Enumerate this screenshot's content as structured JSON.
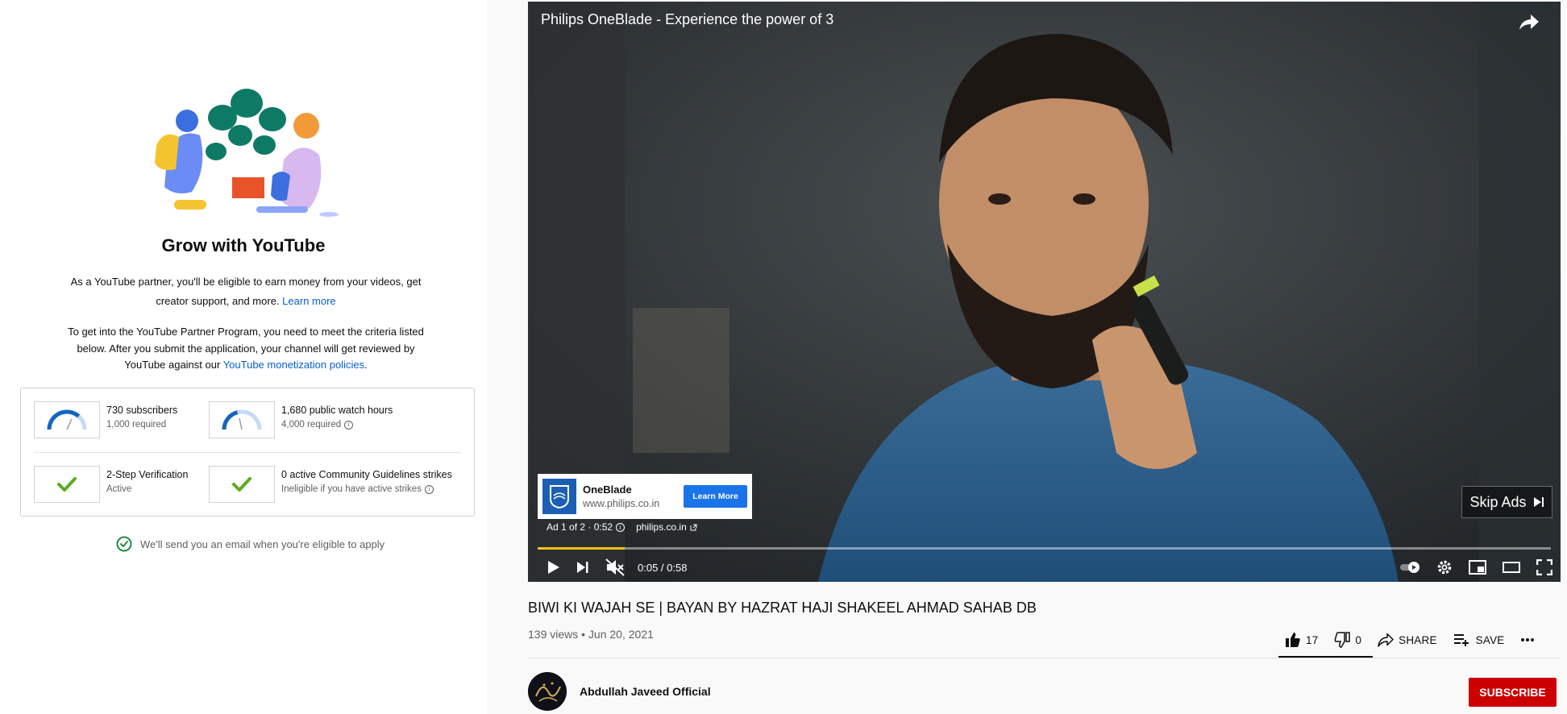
{
  "partner": {
    "title": "Grow with YouTube",
    "para1_text": "As a YouTube partner, you'll be eligible to earn money from your videos, get creator support, and more.",
    "para1_link": "Learn more",
    "para2_text": "To get into the YouTube Partner Program, you need to meet the criteria listed below. After you submit the application, your channel will get reviewed by YouTube against our",
    "para2_link": "YouTube monetization policies",
    "para2_end": ".",
    "criteria": [
      {
        "main": "730 subscribers",
        "sub": "1,000 required",
        "progress": 0.73,
        "icon": "gauge-icon"
      },
      {
        "main": "1,680 public watch hours",
        "sub": "4,000 required",
        "progress": 0.42,
        "icon": "gauge-icon"
      },
      {
        "main": "2-Step Verification",
        "sub": "Active",
        "icon": "checkmark-icon"
      },
      {
        "main": "0 active Community Guidelines strikes",
        "sub": "Ineligible if you have active strikes",
        "icon": "checkmark-icon"
      }
    ],
    "email_note": "We'll send you an email when you're eligible to apply",
    "colors": {
      "accent": "#065fd4",
      "gauge": "#1565c0",
      "check": "#5cac24"
    }
  },
  "player": {
    "title": "Philips OneBlade - Experience the power of 3",
    "ad": {
      "brand": "OneBlade",
      "url": "www.philips.co.in",
      "cta": "Learn More",
      "info": "Ad 1 of 2 · 0:52",
      "domain": "philips.co.in"
    },
    "skip_label": "Skip Ads",
    "time": "0:05 / 0:58",
    "progress": 0.086
  },
  "video": {
    "heading": "BIWI KI WAJAH SE | BAYAN BY HAZRAT HAJI SHAKEEL AHMAD SAHAB DB",
    "meta": "139 views • Jun 20, 2021",
    "likes": "17",
    "dislikes": "0",
    "share": "SHARE",
    "save": "SAVE",
    "channel": "Abdullah Javeed Official",
    "subscribe": "SUBSCRIBE"
  }
}
